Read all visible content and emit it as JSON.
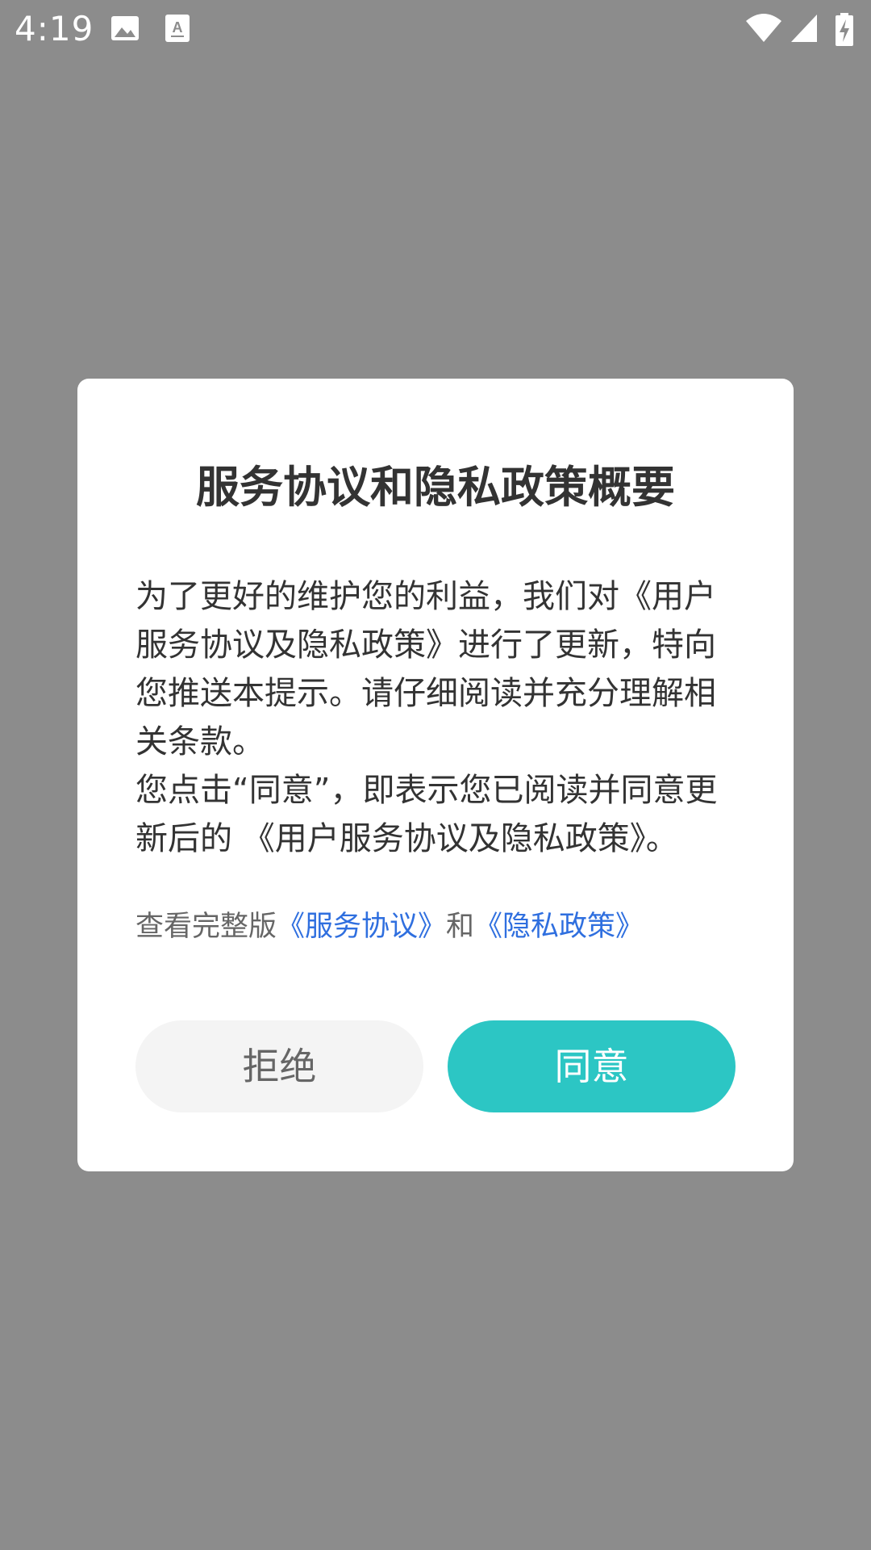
{
  "status_bar": {
    "time": "4:19",
    "left_icons": [
      "image-icon",
      "text-recognition-icon"
    ],
    "right_icons": [
      "wifi-icon",
      "cellular-signal-icon",
      "battery-charging-icon"
    ]
  },
  "dialog": {
    "title": "服务协议和隐私政策概要",
    "body_paragraph_1": "为了更好的维护您的利益，我们对《用户服务协议及隐私政策》进行了更新，特向您推送本提示。请仔细阅读并充分理解相关条款。",
    "body_paragraph_2": "您点击“同意”，即表示您已阅读并同意更新后的 《用户服务协议及隐私政策》。",
    "links": {
      "prefix": "查看完整版",
      "service_agreement": "《服务协议》",
      "conjunction": "和",
      "privacy_policy": "《隐私政策》"
    },
    "reject_label": "拒绝",
    "agree_label": "同意"
  },
  "colors": {
    "overlay": "#8c8c8c",
    "dialog_bg": "#ffffff",
    "agree_button": "#2cc6c4",
    "reject_button": "#f4f4f4",
    "link": "#2f6fdf",
    "text_primary": "#333333",
    "text_secondary": "#666666"
  }
}
